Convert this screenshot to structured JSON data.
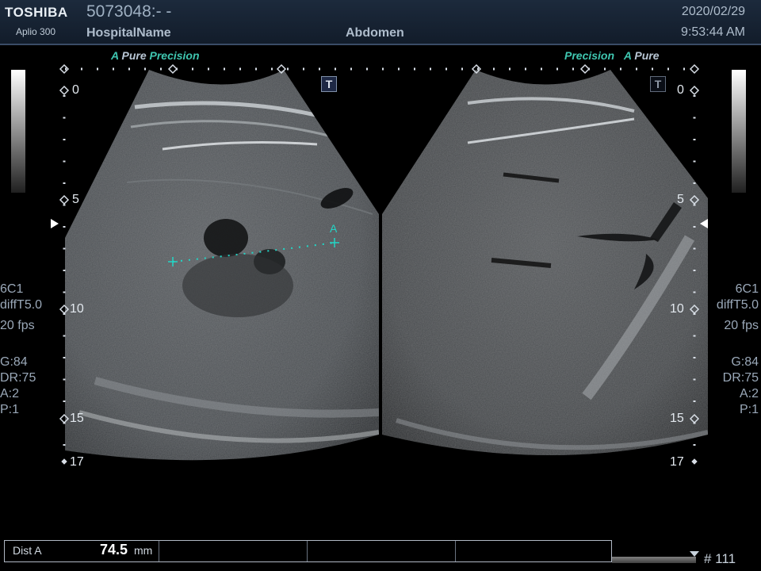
{
  "header": {
    "brand": "TOSHIBA",
    "model": "Aplio 300",
    "patient_id": "5073048:- -",
    "hospital": "HospitalName",
    "preset": "Abdomen",
    "date": "2020/02/29",
    "time": "9:53:44 AM"
  },
  "left_image": {
    "label_a": "A",
    "label_pure": "Pure",
    "label_precision": "Precision",
    "t_icon": "T"
  },
  "right_image": {
    "label_precision": "Precision",
    "label_a": "A",
    "label_pure": "Pure",
    "t_icon": "T"
  },
  "depth_scale": {
    "marks": [
      "0",
      "5",
      "10",
      "15",
      "17"
    ]
  },
  "params": {
    "probe": "6C1",
    "mode": "diffT5.0",
    "fps": "20 fps",
    "gain": "G:84",
    "dr": "DR:75",
    "a": "A:2",
    "p": "P:1"
  },
  "caliper": {
    "label": "A"
  },
  "measurement": {
    "label": "Dist A",
    "value": "74.5",
    "unit": "mm"
  },
  "frame": {
    "count": "# 111"
  },
  "colors": {
    "header_bg": "#16223a",
    "accent_teal": "#3fc6b0",
    "caliper": "#22d6c6"
  },
  "icons": [
    "grayscale-bar",
    "depth-scale",
    "focus-marker",
    "caliper-cross"
  ]
}
